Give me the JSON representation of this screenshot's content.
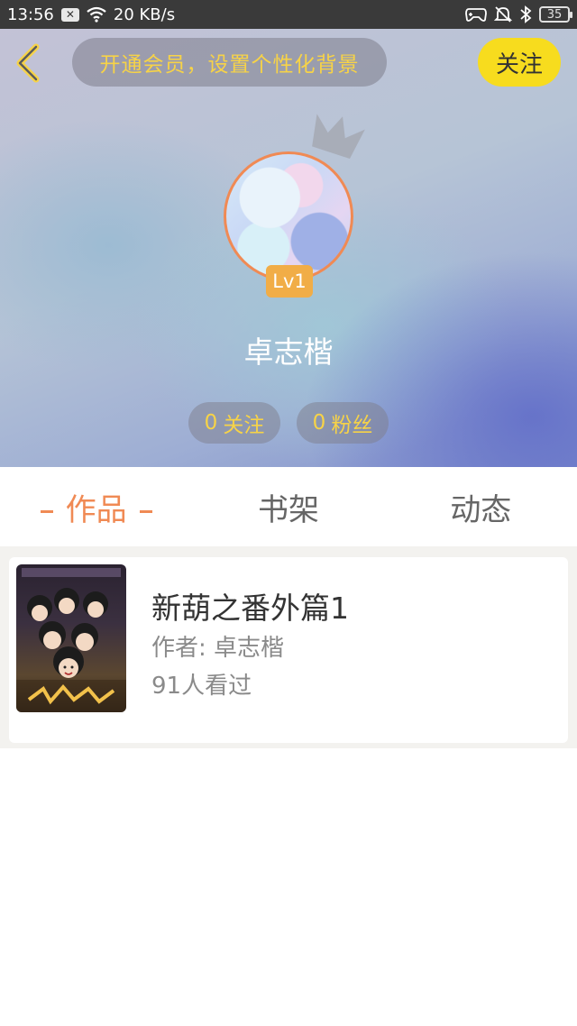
{
  "status_bar": {
    "time": "13:56",
    "network_speed": "20 KB/s",
    "battery": "35",
    "icons": [
      "notification-x-icon",
      "wifi-icon",
      "game-controller-icon",
      "mute-bell-icon",
      "bluetooth-icon",
      "battery-icon"
    ]
  },
  "header": {
    "vip_banner": "开通会员，设置个性化背景",
    "follow_label": "关注",
    "level": "Lv1",
    "username": "卓志楷",
    "following_count": "0",
    "following_label": "关注",
    "fans_count": "0",
    "fans_label": "粉丝",
    "colors": {
      "accent_yellow": "#f7dc1e",
      "banner_text": "#f7d347",
      "avatar_ring": "#f08a54",
      "level_badge": "#f1ad47"
    }
  },
  "tabs": [
    {
      "label": "作品",
      "active": true
    },
    {
      "label": "书架",
      "active": false
    },
    {
      "label": "动态",
      "active": false
    }
  ],
  "works": [
    {
      "title": "新葫之番外篇1",
      "author_label": "作者: ",
      "author": "卓志楷",
      "views": "91人看过"
    }
  ],
  "colors": {
    "active_tab": "#f08a54",
    "inactive_tab": "#666666"
  }
}
